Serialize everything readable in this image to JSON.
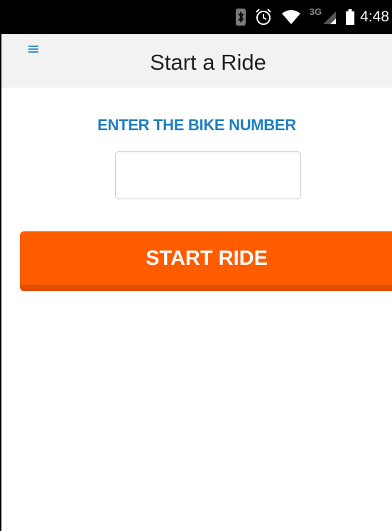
{
  "status_bar": {
    "time": "4:48",
    "network_badge": "3G",
    "icons": [
      "bluetooth-icon",
      "alarm-icon",
      "wifi-icon",
      "signal-icon",
      "battery-icon"
    ]
  },
  "app_bar": {
    "menu_icon": "hamburger-menu-icon",
    "title": "Start a Ride"
  },
  "form": {
    "prompt": "ENTER THE BIKE NUMBER",
    "bike_number_value": "",
    "bike_number_placeholder": ""
  },
  "actions": {
    "start_label": "START RIDE"
  },
  "colors": {
    "accent_blue": "#1f7fbf",
    "button_orange": "#ff5c00",
    "button_shadow": "#e04f00",
    "app_bar_bg": "#f2f2f2"
  }
}
